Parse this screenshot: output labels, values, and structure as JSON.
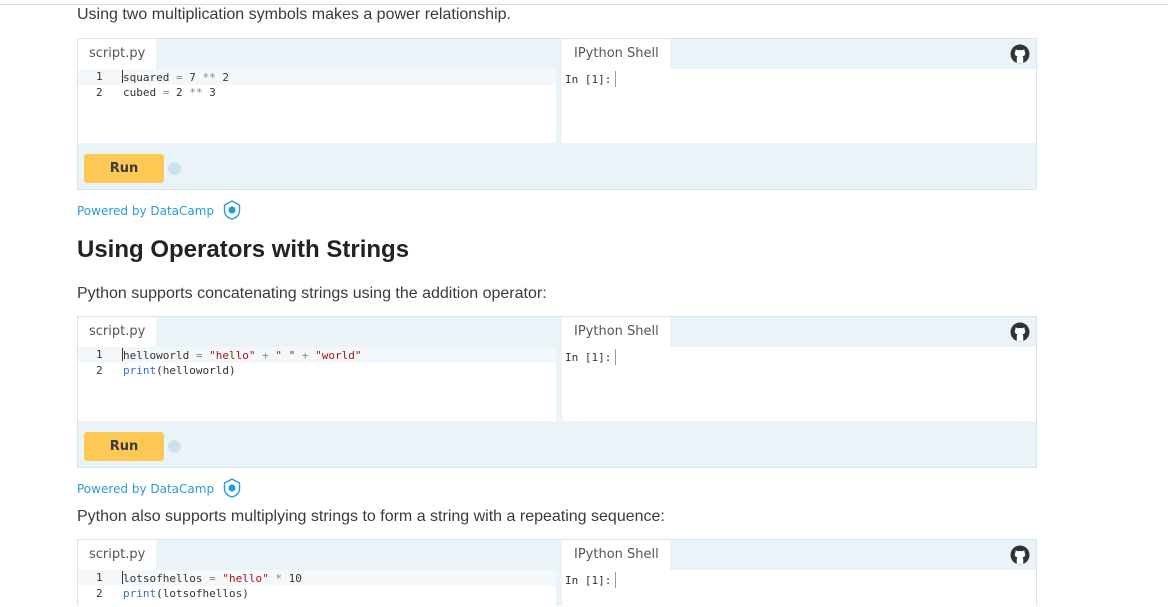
{
  "intro_paragraph": "Using two multiplication symbols makes a power relationship.",
  "section_heading": "Using Operators with Strings",
  "paragraph_concat": "Python supports concatenating strings using the addition operator:",
  "paragraph_multiply": "Python also supports multiplying strings to form a string with a repeating sequence:",
  "widget_labels": {
    "script_tab": "script.py",
    "shell_tab": "IPython Shell",
    "shell_prompt": "In [1]:",
    "run_button": "Run",
    "powered_by": "Powered by DataCamp"
  },
  "widgets": [
    {
      "lines": [
        {
          "num": "1",
          "tokens": [
            {
              "t": "squared",
              "c": ""
            },
            {
              "t": " = ",
              "c": "op"
            },
            {
              "t": "7",
              "c": "num"
            },
            {
              "t": " ** ",
              "c": "op"
            },
            {
              "t": "2",
              "c": "num"
            }
          ]
        },
        {
          "num": "2",
          "tokens": [
            {
              "t": "cubed",
              "c": ""
            },
            {
              "t": " = ",
              "c": "op"
            },
            {
              "t": "2",
              "c": "num"
            },
            {
              "t": " ** ",
              "c": "op"
            },
            {
              "t": "3",
              "c": "num"
            }
          ]
        }
      ]
    },
    {
      "lines": [
        {
          "num": "1",
          "tokens": [
            {
              "t": "helloworld",
              "c": ""
            },
            {
              "t": " = ",
              "c": "op"
            },
            {
              "t": "\"hello\"",
              "c": "str"
            },
            {
              "t": " + ",
              "c": "op"
            },
            {
              "t": "\" \"",
              "c": "str"
            },
            {
              "t": " + ",
              "c": "op"
            },
            {
              "t": "\"world\"",
              "c": "str"
            }
          ]
        },
        {
          "num": "2",
          "tokens": [
            {
              "t": "print",
              "c": "kw"
            },
            {
              "t": "(helloworld)",
              "c": ""
            }
          ]
        }
      ]
    },
    {
      "lines": [
        {
          "num": "1",
          "tokens": [
            {
              "t": "lotsofhellos",
              "c": ""
            },
            {
              "t": " = ",
              "c": "op"
            },
            {
              "t": "\"hello\"",
              "c": "str"
            },
            {
              "t": " * ",
              "c": "op"
            },
            {
              "t": "10",
              "c": "num"
            }
          ]
        },
        {
          "num": "2",
          "tokens": [
            {
              "t": "print",
              "c": "kw"
            },
            {
              "t": "(lotsofhellos)",
              "c": ""
            }
          ]
        }
      ]
    }
  ],
  "colors": {
    "run_button": "#fec855",
    "link": "#2a9bd2",
    "widget_border": "#d6e4ee",
    "widget_bg": "#eaf3f8"
  },
  "icons": {
    "github": "github-icon",
    "datacamp": "datacamp-logo-icon"
  }
}
